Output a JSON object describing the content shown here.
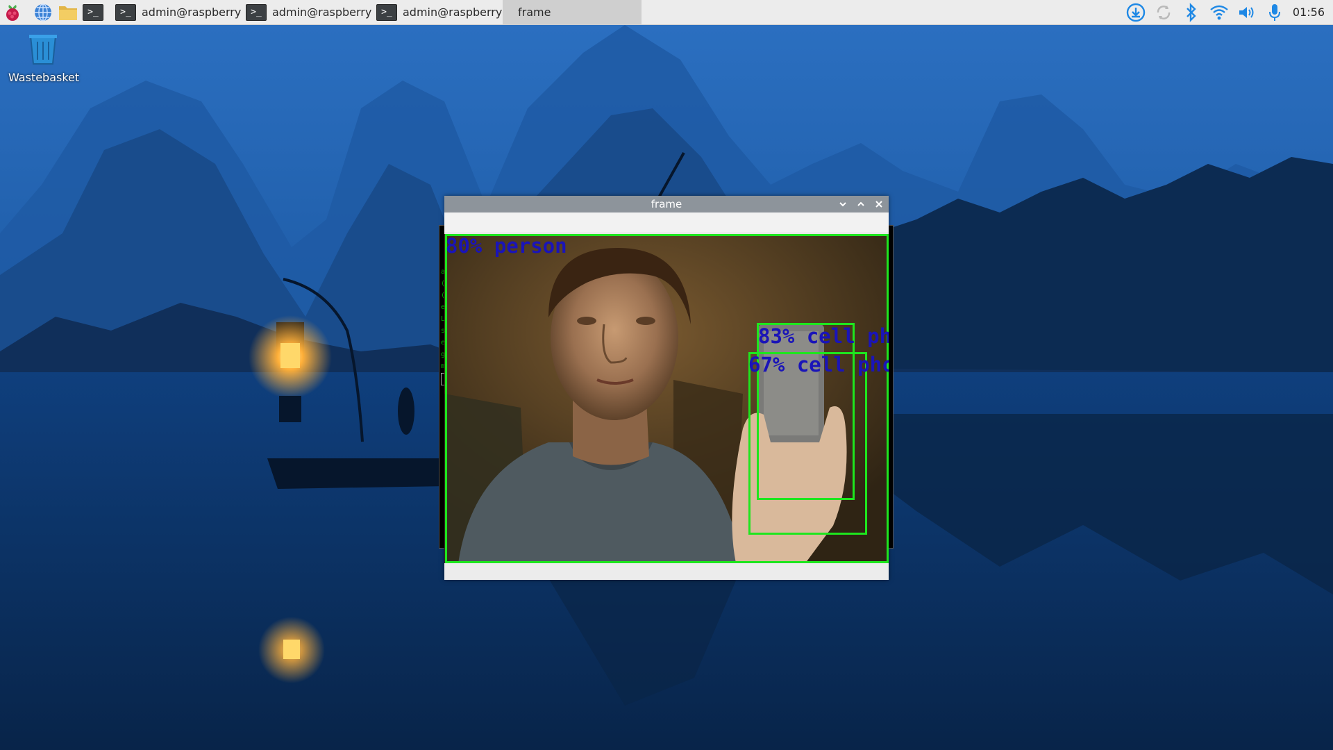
{
  "taskbar": {
    "tasks": [
      {
        "label": "admin@raspberrypi: ..."
      },
      {
        "label": "admin@raspberrypi: ..."
      },
      {
        "label": "admin@raspberrypi: ..."
      },
      {
        "label": "frame",
        "active": true
      }
    ],
    "launchers": [
      "raspberry-menu-icon",
      "web-browser-icon",
      "file-manager-icon",
      "terminal-icon"
    ],
    "tray": [
      "download-icon",
      "update-icon",
      "bluetooth-icon",
      "wifi-icon",
      "volume-icon",
      "microphone-icon"
    ],
    "clock": "01:56"
  },
  "desktop": {
    "icons": [
      {
        "label": "Wastebasket",
        "icon": "trash-icon"
      }
    ]
  },
  "frame_window": {
    "title": "frame",
    "controls": [
      "minimize",
      "maximize",
      "close"
    ],
    "detections": [
      {
        "label": "80% person"
      },
      {
        "label": "83% cell ph"
      },
      {
        "label": "67% cell phc"
      }
    ]
  },
  "background_terminal": {
    "visible_chars": "a\n(\n(\ne\nL\ns\ne\ng\nm"
  },
  "colors": {
    "taskbar": "#ececec",
    "titlebar": "#8d949b",
    "detection_box": "#1ee61e",
    "detection_text": "#1a14b8"
  }
}
